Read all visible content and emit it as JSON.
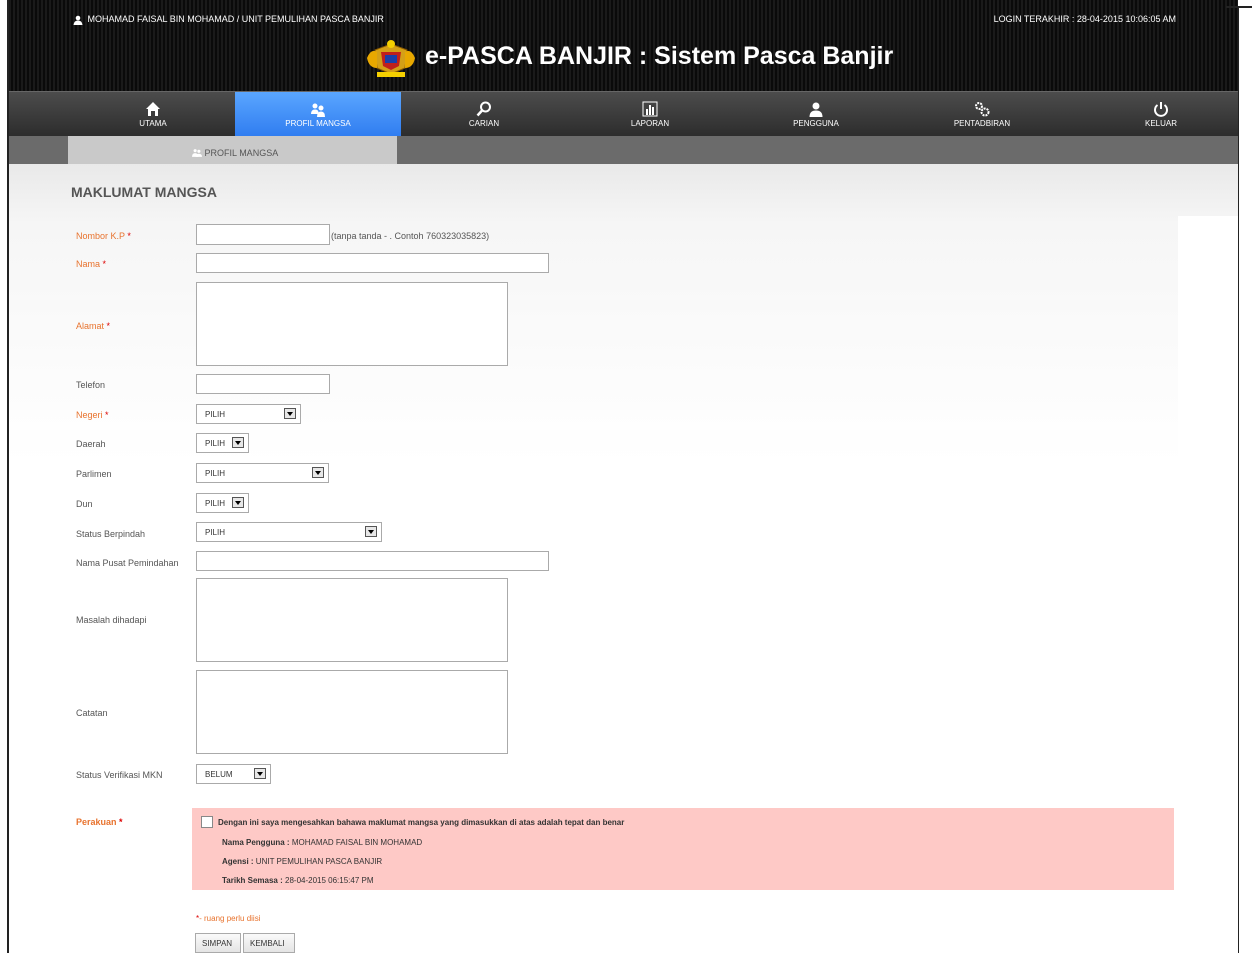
{
  "header": {
    "user": "MOHAMAD FAISAL BIN MOHAMAD / UNIT PEMULIHAN PASCA BANJIR",
    "last_login": "LOGIN TERAKHIR : 28-04-2015 10:06:05 AM",
    "title": "e-PASCA BANJIR : Sistem Pasca Banjir"
  },
  "nav": [
    {
      "label": "UTAMA",
      "icon": "home-icon"
    },
    {
      "label": "PROFIL MANGSA",
      "icon": "users-icon"
    },
    {
      "label": "CARIAN",
      "icon": "search-icon"
    },
    {
      "label": "LAPORAN",
      "icon": "chart-icon"
    },
    {
      "label": "PENGGUNA",
      "icon": "user-icon"
    },
    {
      "label": "PENTADBIRAN",
      "icon": "gears-icon"
    },
    {
      "label": "KELUAR",
      "icon": "power-icon"
    }
  ],
  "subnav": {
    "tab": "PROFIL MANGSA"
  },
  "form": {
    "heading": "MAKLUMAT MANGSA",
    "nokp": {
      "label": "Nombor K.P",
      "hint": "(tanpa tanda - . Contoh 760323035823)"
    },
    "nama": {
      "label": "Nama"
    },
    "alamat": {
      "label": "Alamat"
    },
    "telefon": {
      "label": "Telefon"
    },
    "negeri": {
      "label": "Negeri",
      "value": "PILIH"
    },
    "daerah": {
      "label": "Daerah",
      "value": "PILIH"
    },
    "parlimen": {
      "label": "Parlimen",
      "value": "PILIH"
    },
    "dun": {
      "label": "Dun",
      "value": "PILIH"
    },
    "status_berpindah": {
      "label": "Status Berpindah",
      "value": "PILIH"
    },
    "pusat": {
      "label": "Nama Pusat Pemindahan"
    },
    "masalah": {
      "label": "Masalah dihadapi"
    },
    "catatan": {
      "label": "Catatan"
    },
    "verifikasi": {
      "label": "Status Verifikasi MKN",
      "value": "BELUM"
    },
    "perakuan": {
      "label": "Perakuan",
      "statement": "Dengan ini saya mengesahkan bahawa maklumat mangsa yang dimasukkan di atas adalah tepat dan benar",
      "nama_pengguna_label": "Nama Pengguna :",
      "nama_pengguna": "MOHAMAD FAISAL BIN MOHAMAD",
      "agensi_label": "Agensi :",
      "agensi": "UNIT PEMULIHAN PASCA BANJIR",
      "tarikh_label": "Tarikh Semasa :",
      "tarikh": "28-04-2015 06:15:47 PM"
    },
    "required_note": "- ruang perlu diisi",
    "buttons": {
      "simpan": "SIMPAN",
      "kembali": "KEMBALI"
    }
  }
}
